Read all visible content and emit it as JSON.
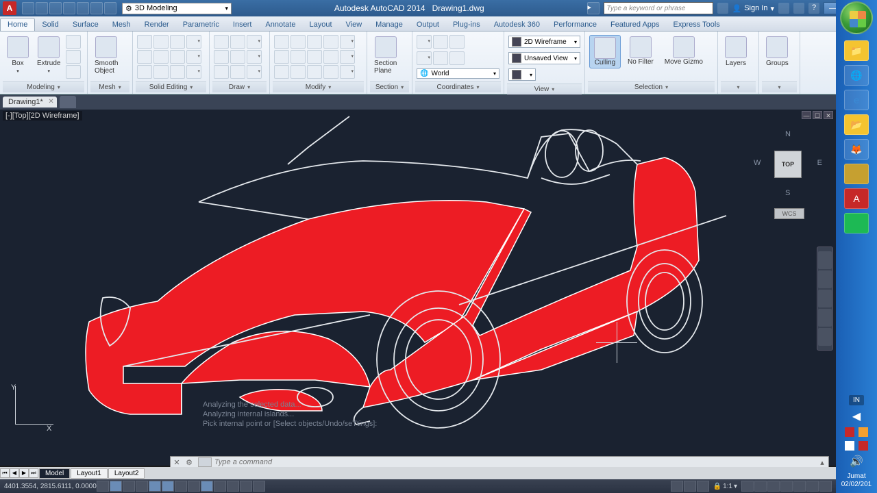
{
  "title": {
    "app": "Autodesk AutoCAD 2014",
    "file": "Drawing1.dwg"
  },
  "workspace": "3D Modeling",
  "search_placeholder": "Type a keyword or phrase",
  "signin": "Sign In",
  "ribbon_tabs": [
    "Home",
    "Solid",
    "Surface",
    "Mesh",
    "Render",
    "Parametric",
    "Insert",
    "Annotate",
    "Layout",
    "View",
    "Manage",
    "Output",
    "Plug-ins",
    "Autodesk 360",
    "Performance",
    "Featured Apps",
    "Express Tools"
  ],
  "active_tab": "Home",
  "panels": {
    "modeling": {
      "label": "Modeling",
      "box": "Box",
      "extrude": "Extrude"
    },
    "mesh": {
      "label": "Mesh",
      "smooth": "Smooth\nObject"
    },
    "solid_editing": {
      "label": "Solid Editing"
    },
    "draw": {
      "label": "Draw"
    },
    "modify": {
      "label": "Modify"
    },
    "section": {
      "label": "Section",
      "plane": "Section\nPlane"
    },
    "coordinates": {
      "label": "Coordinates",
      "world": "World"
    },
    "view": {
      "label": "View",
      "style": "2D Wireframe",
      "unsaved": "Unsaved View"
    },
    "selection": {
      "label": "Selection",
      "culling": "Culling",
      "nofilter": "No Filter",
      "gizmo": "Move Gizmo"
    },
    "layers": "Layers",
    "groups": "Groups"
  },
  "doc_tab": "Drawing1*",
  "viewport": {
    "label": "[-][Top][2D Wireframe]"
  },
  "viewcube": {
    "n": "N",
    "s": "S",
    "e": "E",
    "w": "W",
    "top": "TOP",
    "wcs": "WCS"
  },
  "cmd_history": [
    "Analyzing the selected data...",
    "Analyzing internal islands...",
    "Pick internal point or [Select objects/Undo/seTtings]:"
  ],
  "cmd_placeholder": "Type a command",
  "layout_tabs": [
    "Model",
    "Layout1",
    "Layout2"
  ],
  "coords": "4401.3554, 2815.6111, 0.0000",
  "scale": "1:1",
  "taskbar": {
    "lang": "IN",
    "day": "Jumat",
    "date": "02/02/201"
  }
}
